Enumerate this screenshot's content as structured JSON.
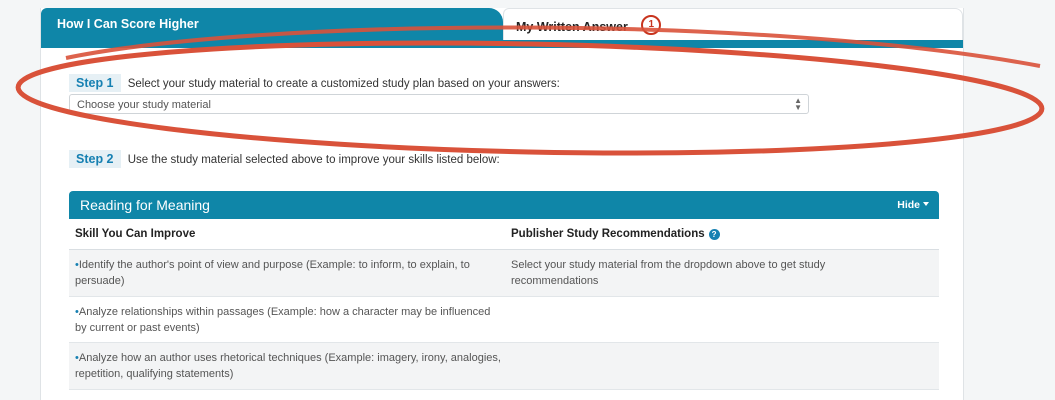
{
  "tabs": {
    "active_label": "How I Can Score Higher",
    "inactive_label": "My Written Answer",
    "badge": "1"
  },
  "step1": {
    "label": "Step 1",
    "text": "Select your study material to create a customized study plan based on your answers:",
    "select_value": "Choose your study material"
  },
  "step2": {
    "label": "Step 2",
    "text": "Use the study material selected above to improve your skills listed below:"
  },
  "section": {
    "title": "Reading for Meaning",
    "hide_label": "Hide"
  },
  "table": {
    "headers": [
      "Skill You Can Improve",
      "Publisher Study Recommendations"
    ],
    "rows": [
      {
        "skill": "Identify the author's point of view and purpose (Example: to inform, to explain, to persuade)",
        "recommendation": "Select your study material from the dropdown above to get study recommendations"
      },
      {
        "skill": "Analyze relationships within passages (Example: how a character may be influenced by current or past events)",
        "recommendation": ""
      },
      {
        "skill": "Analyze how an author uses rhetorical techniques (Example: imagery, irony, analogies, repetition, qualifying statements)",
        "recommendation": ""
      }
    ]
  },
  "colors": {
    "header_teal": "#0f86a8",
    "step_blue": "#1680b2",
    "annotation_red": "#d9523a"
  },
  "icons": [
    "info-circle-icon",
    "caret-down-icon",
    "select-arrows-icon"
  ]
}
